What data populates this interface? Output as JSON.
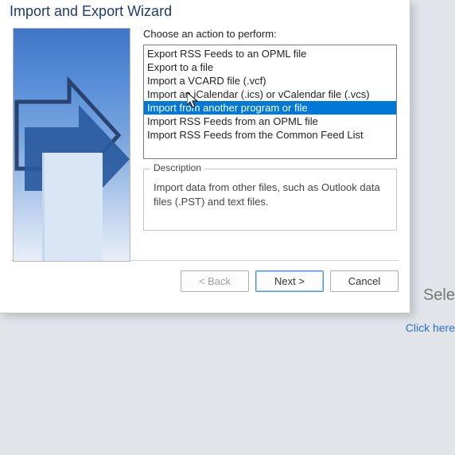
{
  "dialog": {
    "title": "Import and Export Wizard",
    "prompt": "Choose an action to perform:",
    "options": [
      "Export RSS Feeds to an OPML file",
      "Export to a file",
      "Import a VCARD file (.vcf)",
      "Import an iCalendar (.ics) or vCalendar file (.vcs)",
      "Import from another program or file",
      "Import RSS Feeds from an OPML file",
      "Import RSS Feeds from the Common Feed List"
    ],
    "selected_index": 4,
    "description_heading": "Description",
    "description_text": "Import data from other files, such as Outlook data files (.PST) and text files.",
    "buttons": {
      "back": "< Back",
      "next": "Next >",
      "cancel": "Cancel"
    }
  },
  "background": {
    "right_heading_fragment": "Sele",
    "link_fragment": "Click here"
  }
}
